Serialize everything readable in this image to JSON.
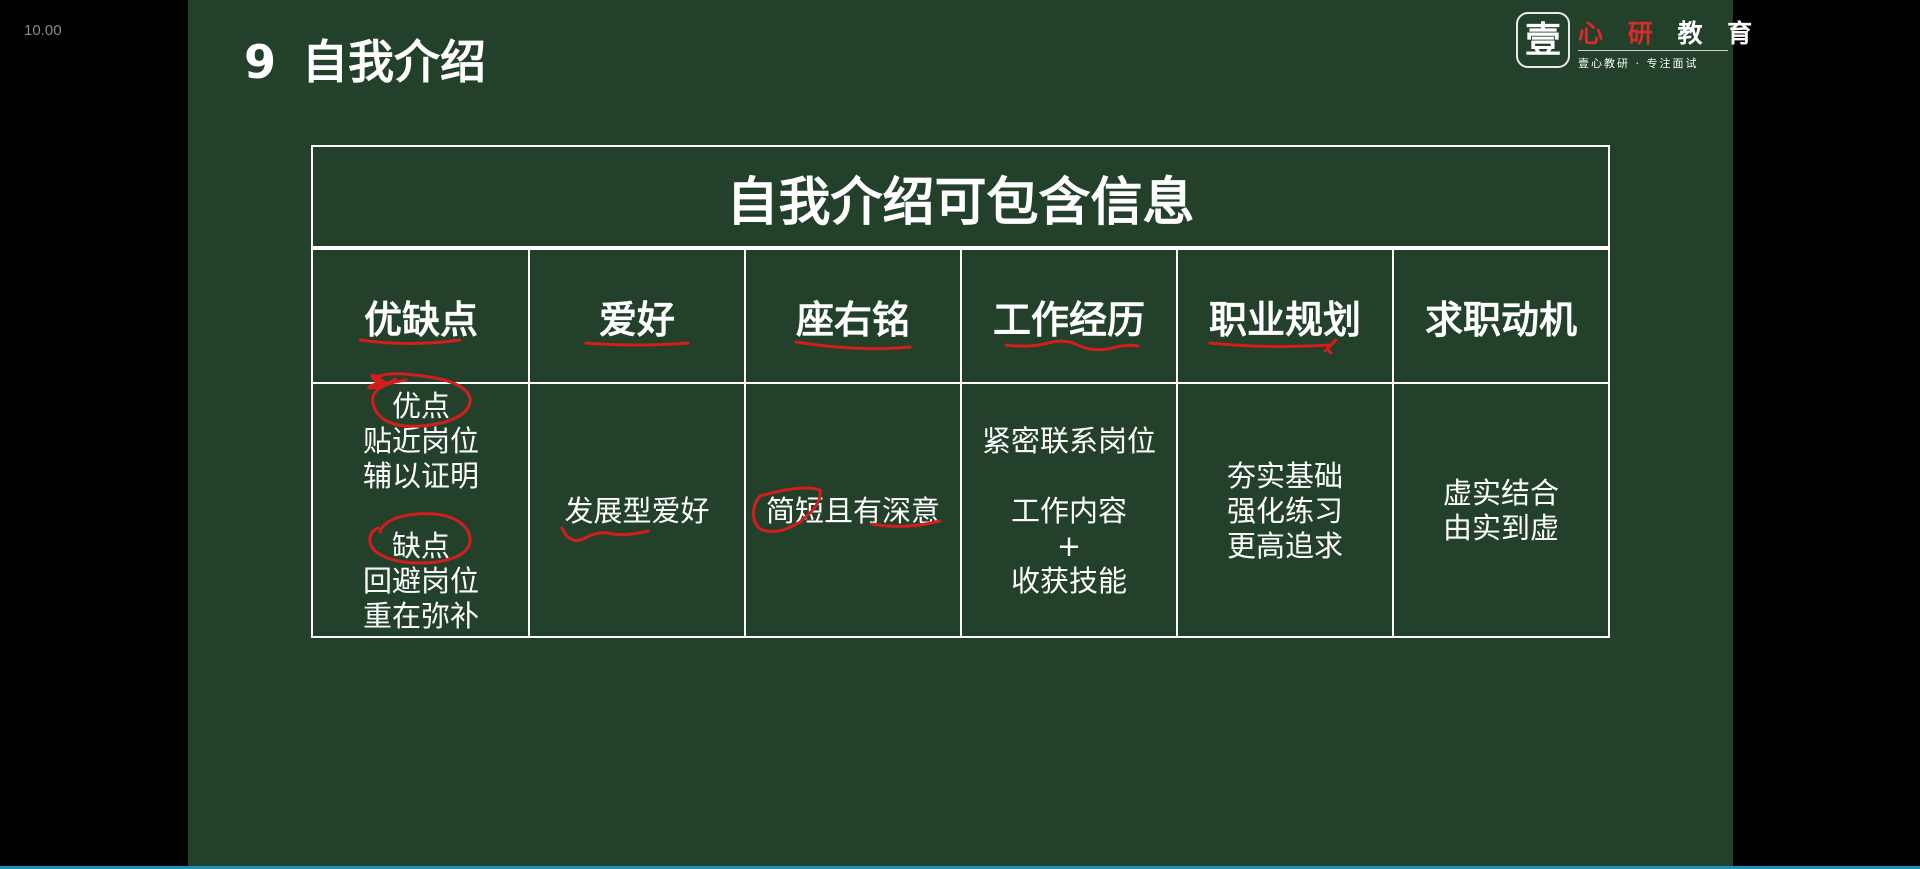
{
  "corner_label": "10.00",
  "slide": {
    "number": "9",
    "title": "自我介绍"
  },
  "logo": {
    "seal_char": "壹",
    "name_red": "心 研",
    "name_white": "教 育",
    "tagline": "壹心教研 · 专注面试"
  },
  "table": {
    "heading": "自我介绍可包含信息",
    "columns": [
      {
        "category": "优缺点",
        "lines": [
          "优点",
          "贴近岗位",
          "辅以证明",
          "",
          "缺点",
          "回避岗位",
          "重在弥补"
        ]
      },
      {
        "category": "爱好",
        "lines": [
          "发展型爱好"
        ]
      },
      {
        "category": "座右铭",
        "lines": [
          "简短且有深意"
        ]
      },
      {
        "category": "工作经历",
        "lines": [
          "紧密联系岗位",
          "",
          "工作内容",
          "+",
          "收获技能"
        ]
      },
      {
        "category": "职业规划",
        "lines": [
          "夯实基础",
          "强化练习",
          "更高追求"
        ]
      },
      {
        "category": "求职动机",
        "lines": [
          "虚实结合",
          "由实到虚"
        ]
      }
    ]
  },
  "colors": {
    "slide_background": "#22402a",
    "annotation_ink": "#d41e1e",
    "text": "#ffffff"
  }
}
